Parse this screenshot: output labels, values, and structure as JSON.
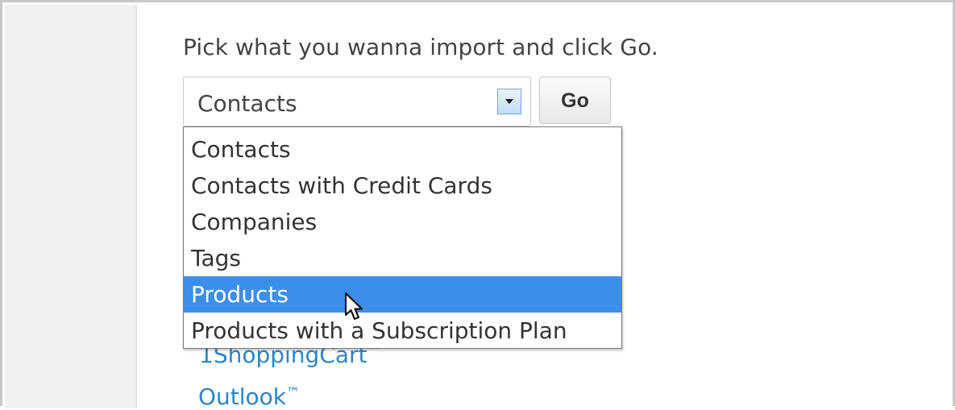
{
  "prompt": "Pick what you wanna import and click Go.",
  "select": {
    "value": "Contacts",
    "options": [
      "Contacts",
      "Contacts with Credit Cards",
      "Companies",
      "Tags",
      "Products",
      "Products with a Subscription Plan"
    ],
    "highlighted_option": "Products",
    "arrow_icon": "chevron-down-icon"
  },
  "go_button": {
    "label": "Go"
  },
  "links": [
    {
      "label": "1ShoppingCart",
      "mark": "™"
    },
    {
      "label": "Outlook",
      "mark": "™"
    }
  ],
  "colors": {
    "highlight": "#3d8ee8",
    "link": "#2a86c8",
    "text": "#444444"
  },
  "cursor_icon": "mouse-pointer-icon"
}
